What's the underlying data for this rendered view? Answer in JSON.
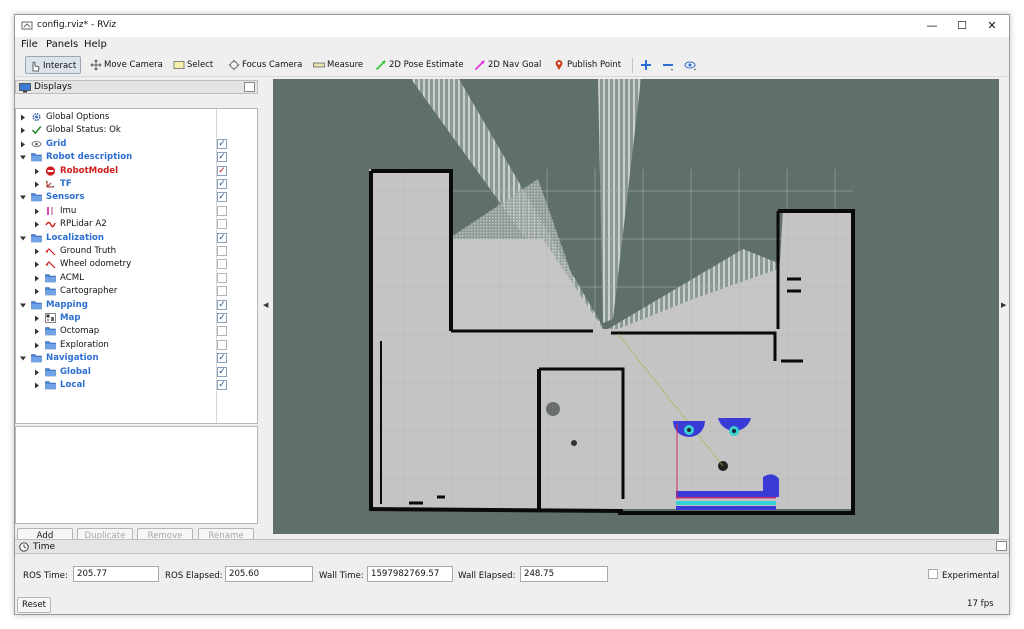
{
  "window": {
    "title": "config.rviz* - RViz",
    "controls": {
      "minimize": "—",
      "maximize": "☐",
      "close": "✕"
    }
  },
  "menu": [
    "File",
    "Panels",
    "Help"
  ],
  "toolbar": {
    "tools": [
      {
        "label": "Interact",
        "icon": "cursor-hand-icon",
        "active": true
      },
      {
        "label": "Move Camera",
        "icon": "move-camera-icon"
      },
      {
        "label": "Select",
        "icon": "select-rectangle-icon"
      },
      {
        "label": "Focus Camera",
        "icon": "focus-camera-icon"
      },
      {
        "label": "Measure",
        "icon": "ruler-icon"
      },
      {
        "label": "2D Pose Estimate",
        "icon": "green-arrow-icon"
      },
      {
        "label": "2D Nav Goal",
        "icon": "pink-arrow-icon"
      },
      {
        "label": "Publish Point",
        "icon": "map-pin-icon"
      }
    ],
    "extra_icons": [
      "add-tool-icon",
      "remove-tool-icon",
      "camera-type-icon"
    ]
  },
  "displays_panel": {
    "title": "Displays",
    "rows": [
      {
        "label": "Global Options",
        "level": 0,
        "expanded": false,
        "style": "normal",
        "icon": "gear-icon",
        "checked": null
      },
      {
        "label": "Global Status: Ok",
        "level": 0,
        "expanded": false,
        "style": "normal",
        "icon": "check-icon",
        "checked": null
      },
      {
        "label": "Grid",
        "level": 0,
        "expanded": false,
        "style": "group",
        "icon": "grid-icon",
        "checked": true
      },
      {
        "label": "Robot description",
        "level": 0,
        "expanded": true,
        "style": "group",
        "icon": "folder-icon",
        "checked": true
      },
      {
        "label": "RobotModel",
        "level": 1,
        "expanded": false,
        "style": "err",
        "icon": "error-icon",
        "checked": true,
        "check_color": "red"
      },
      {
        "label": "TF",
        "level": 1,
        "expanded": false,
        "style": "group",
        "icon": "tf-icon",
        "checked": true
      },
      {
        "label": "Sensors",
        "level": 0,
        "expanded": true,
        "style": "group",
        "icon": "folder-icon",
        "checked": true
      },
      {
        "label": "Imu",
        "level": 1,
        "expanded": false,
        "style": "normal",
        "icon": "imu-icon",
        "checked": false
      },
      {
        "label": "RPLidar A2",
        "level": 1,
        "expanded": false,
        "style": "normal",
        "icon": "laser-icon",
        "checked": false
      },
      {
        "label": "Localization",
        "level": 0,
        "expanded": true,
        "style": "group",
        "icon": "folder-icon",
        "checked": true
      },
      {
        "label": "Ground Truth",
        "level": 1,
        "expanded": false,
        "style": "normal",
        "icon": "odometry-icon",
        "checked": false
      },
      {
        "label": "Wheel odometry",
        "level": 1,
        "expanded": false,
        "style": "normal",
        "icon": "odometry-icon",
        "checked": false
      },
      {
        "label": "ACML",
        "level": 1,
        "expanded": false,
        "style": "normal",
        "icon": "folder-icon",
        "checked": false
      },
      {
        "label": "Cartographer",
        "level": 1,
        "expanded": false,
        "style": "normal",
        "icon": "folder-icon",
        "checked": false
      },
      {
        "label": "Mapping",
        "level": 0,
        "expanded": true,
        "style": "group",
        "icon": "folder-icon",
        "checked": true
      },
      {
        "label": "Map",
        "level": 1,
        "expanded": false,
        "style": "group",
        "icon": "map-icon",
        "checked": true
      },
      {
        "label": "Octomap",
        "level": 1,
        "expanded": false,
        "style": "normal",
        "icon": "folder-icon",
        "checked": false
      },
      {
        "label": "Exploration",
        "level": 1,
        "expanded": false,
        "style": "normal",
        "icon": "folder-icon",
        "checked": false
      },
      {
        "label": "Navigation",
        "level": 0,
        "expanded": true,
        "style": "group",
        "icon": "folder-icon",
        "checked": true
      },
      {
        "label": "Global",
        "level": 1,
        "expanded": false,
        "style": "group",
        "icon": "folder-icon",
        "checked": true
      },
      {
        "label": "Local",
        "level": 1,
        "expanded": false,
        "style": "group",
        "icon": "folder-icon",
        "checked": true
      }
    ],
    "buttons": [
      {
        "label": "Add",
        "enabled": true
      },
      {
        "label": "Duplicate",
        "enabled": false
      },
      {
        "label": "Remove",
        "enabled": false
      },
      {
        "label": "Rename",
        "enabled": false
      }
    ]
  },
  "time_panel": {
    "title": "Time",
    "ros_time_label": "ROS Time:",
    "ros_time": "205.77",
    "ros_elapsed_label": "ROS Elapsed:",
    "ros_elapsed": "205.60",
    "wall_time_label": "Wall Time:",
    "wall_time": "1597982769.57",
    "wall_elapsed_label": "Wall Elapsed:",
    "wall_elapsed": "248.75",
    "experimental_label": "Experimental",
    "experimental_checked": false,
    "reset_label": "Reset",
    "fps": "17 fps"
  },
  "colors": {
    "view_background": "#5f6f6c",
    "free_space": "#c4c4c4",
    "walls": "#0a0a0a",
    "group_text": "#2d6fd0",
    "error_text": "#d21d1d",
    "costmap_blue": "#3a3ad6",
    "costmap_cyan": "#36d0d0"
  }
}
